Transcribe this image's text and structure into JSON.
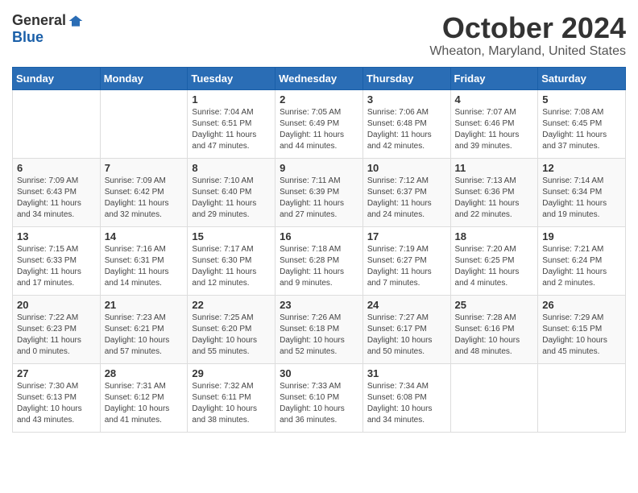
{
  "header": {
    "logo_general": "General",
    "logo_blue": "Blue",
    "month_title": "October 2024",
    "location": "Wheaton, Maryland, United States"
  },
  "days_of_week": [
    "Sunday",
    "Monday",
    "Tuesday",
    "Wednesday",
    "Thursday",
    "Friday",
    "Saturday"
  ],
  "weeks": [
    [
      {
        "day": "",
        "info": ""
      },
      {
        "day": "",
        "info": ""
      },
      {
        "day": "1",
        "info": "Sunrise: 7:04 AM\nSunset: 6:51 PM\nDaylight: 11 hours and 47 minutes."
      },
      {
        "day": "2",
        "info": "Sunrise: 7:05 AM\nSunset: 6:49 PM\nDaylight: 11 hours and 44 minutes."
      },
      {
        "day": "3",
        "info": "Sunrise: 7:06 AM\nSunset: 6:48 PM\nDaylight: 11 hours and 42 minutes."
      },
      {
        "day": "4",
        "info": "Sunrise: 7:07 AM\nSunset: 6:46 PM\nDaylight: 11 hours and 39 minutes."
      },
      {
        "day": "5",
        "info": "Sunrise: 7:08 AM\nSunset: 6:45 PM\nDaylight: 11 hours and 37 minutes."
      }
    ],
    [
      {
        "day": "6",
        "info": "Sunrise: 7:09 AM\nSunset: 6:43 PM\nDaylight: 11 hours and 34 minutes."
      },
      {
        "day": "7",
        "info": "Sunrise: 7:09 AM\nSunset: 6:42 PM\nDaylight: 11 hours and 32 minutes."
      },
      {
        "day": "8",
        "info": "Sunrise: 7:10 AM\nSunset: 6:40 PM\nDaylight: 11 hours and 29 minutes."
      },
      {
        "day": "9",
        "info": "Sunrise: 7:11 AM\nSunset: 6:39 PM\nDaylight: 11 hours and 27 minutes."
      },
      {
        "day": "10",
        "info": "Sunrise: 7:12 AM\nSunset: 6:37 PM\nDaylight: 11 hours and 24 minutes."
      },
      {
        "day": "11",
        "info": "Sunrise: 7:13 AM\nSunset: 6:36 PM\nDaylight: 11 hours and 22 minutes."
      },
      {
        "day": "12",
        "info": "Sunrise: 7:14 AM\nSunset: 6:34 PM\nDaylight: 11 hours and 19 minutes."
      }
    ],
    [
      {
        "day": "13",
        "info": "Sunrise: 7:15 AM\nSunset: 6:33 PM\nDaylight: 11 hours and 17 minutes."
      },
      {
        "day": "14",
        "info": "Sunrise: 7:16 AM\nSunset: 6:31 PM\nDaylight: 11 hours and 14 minutes."
      },
      {
        "day": "15",
        "info": "Sunrise: 7:17 AM\nSunset: 6:30 PM\nDaylight: 11 hours and 12 minutes."
      },
      {
        "day": "16",
        "info": "Sunrise: 7:18 AM\nSunset: 6:28 PM\nDaylight: 11 hours and 9 minutes."
      },
      {
        "day": "17",
        "info": "Sunrise: 7:19 AM\nSunset: 6:27 PM\nDaylight: 11 hours and 7 minutes."
      },
      {
        "day": "18",
        "info": "Sunrise: 7:20 AM\nSunset: 6:25 PM\nDaylight: 11 hours and 4 minutes."
      },
      {
        "day": "19",
        "info": "Sunrise: 7:21 AM\nSunset: 6:24 PM\nDaylight: 11 hours and 2 minutes."
      }
    ],
    [
      {
        "day": "20",
        "info": "Sunrise: 7:22 AM\nSunset: 6:23 PM\nDaylight: 11 hours and 0 minutes."
      },
      {
        "day": "21",
        "info": "Sunrise: 7:23 AM\nSunset: 6:21 PM\nDaylight: 10 hours and 57 minutes."
      },
      {
        "day": "22",
        "info": "Sunrise: 7:25 AM\nSunset: 6:20 PM\nDaylight: 10 hours and 55 minutes."
      },
      {
        "day": "23",
        "info": "Sunrise: 7:26 AM\nSunset: 6:18 PM\nDaylight: 10 hours and 52 minutes."
      },
      {
        "day": "24",
        "info": "Sunrise: 7:27 AM\nSunset: 6:17 PM\nDaylight: 10 hours and 50 minutes."
      },
      {
        "day": "25",
        "info": "Sunrise: 7:28 AM\nSunset: 6:16 PM\nDaylight: 10 hours and 48 minutes."
      },
      {
        "day": "26",
        "info": "Sunrise: 7:29 AM\nSunset: 6:15 PM\nDaylight: 10 hours and 45 minutes."
      }
    ],
    [
      {
        "day": "27",
        "info": "Sunrise: 7:30 AM\nSunset: 6:13 PM\nDaylight: 10 hours and 43 minutes."
      },
      {
        "day": "28",
        "info": "Sunrise: 7:31 AM\nSunset: 6:12 PM\nDaylight: 10 hours and 41 minutes."
      },
      {
        "day": "29",
        "info": "Sunrise: 7:32 AM\nSunset: 6:11 PM\nDaylight: 10 hours and 38 minutes."
      },
      {
        "day": "30",
        "info": "Sunrise: 7:33 AM\nSunset: 6:10 PM\nDaylight: 10 hours and 36 minutes."
      },
      {
        "day": "31",
        "info": "Sunrise: 7:34 AM\nSunset: 6:08 PM\nDaylight: 10 hours and 34 minutes."
      },
      {
        "day": "",
        "info": ""
      },
      {
        "day": "",
        "info": ""
      }
    ]
  ]
}
